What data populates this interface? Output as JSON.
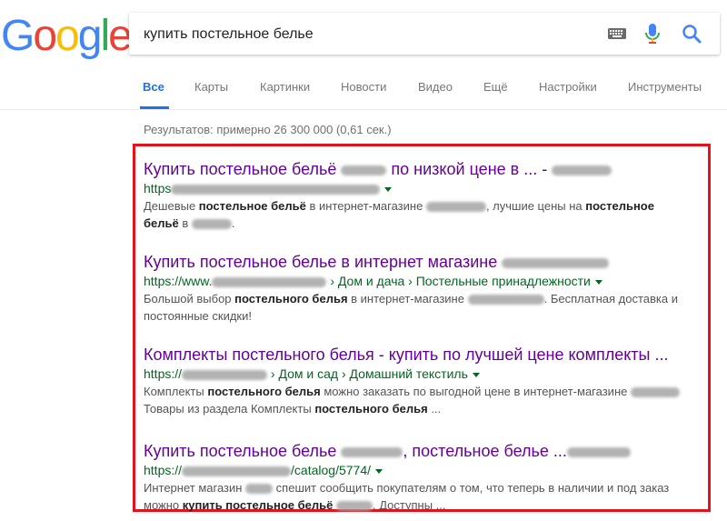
{
  "logo": {
    "letters": [
      "G",
      "o",
      "o",
      "g",
      "l",
      "e"
    ],
    "colors": [
      "#4285f4",
      "#ea4335",
      "#fbbc05",
      "#4285f4",
      "#34a853",
      "#ea4335"
    ]
  },
  "search": {
    "query": "купить постельное белье",
    "icons": [
      "keyboard-icon",
      "microphone-icon",
      "search-icon"
    ]
  },
  "tabs": [
    {
      "label": "Все",
      "active": true
    },
    {
      "label": "Карты"
    },
    {
      "label": "Картинки"
    },
    {
      "label": "Новости"
    },
    {
      "label": "Видео"
    },
    {
      "label": "Ещё"
    },
    {
      "label": "Настройки"
    },
    {
      "label": "Инструменты"
    }
  ],
  "stats": "Результатов: примерно 26 300 000 (0,61 сек.)",
  "colors": {
    "accent": "#1a73e8",
    "visited_title": "#660099",
    "url_green": "#006621",
    "highlight_border": "#e4131b"
  },
  "results": [
    {
      "title_a": "Купить постельное бельё",
      "title_b": "по низкой цене в ... -",
      "url_a": "https",
      "url_b": "",
      "snip1_a": "Дешевые ",
      "snip1_b1": "постельное бельё",
      "snip1_c": " в интернет-магазине ",
      "snip1_d": ", лучшие цены на ",
      "snip1_e": "постельное",
      "snip2_a": "бельё",
      "snip2_b": " в ",
      "snip2_c": "."
    },
    {
      "title_a": "Купить постельное белье в интернет магазине",
      "url_a": "https://www.",
      "url_b": "› Дом и дача › Постельные принадлежности",
      "snip1_a": "Большой выбор ",
      "snip1_b1": "постельного белья",
      "snip1_c": " в интернет-магазине ",
      "snip1_d": ". Бесплатная доставка и",
      "snip2_a": "постоянные скидки!"
    },
    {
      "title_a": "Комплекты постельного белья - купить по лучшей цене комплекты ...",
      "url_a": "https://",
      "url_b": "› Дом и сад › Домашний текстиль",
      "snip1_a": "Комплекты ",
      "snip1_b1": "постельного белья",
      "snip1_c": " можно заказать по выгодной цене в интернет-магазине",
      "snip2_a": "Товары из раздела Комплекты ",
      "snip2_b": "постельного белья",
      "snip2_c": " ..."
    },
    {
      "title_a": "Купить постельное белье",
      "title_b": ", постельное белье ...",
      "url_a": "https://",
      "url_b": "/catalog/5774/",
      "snip1_a": "Интернет магазин ",
      "snip1_c": " спешит сообщить покупателям о том, что теперь в наличии и под заказ",
      "snip2_a": "можно ",
      "snip2_b": "купить постельное бельё",
      "snip2_c": ". Доступны ..."
    }
  ]
}
